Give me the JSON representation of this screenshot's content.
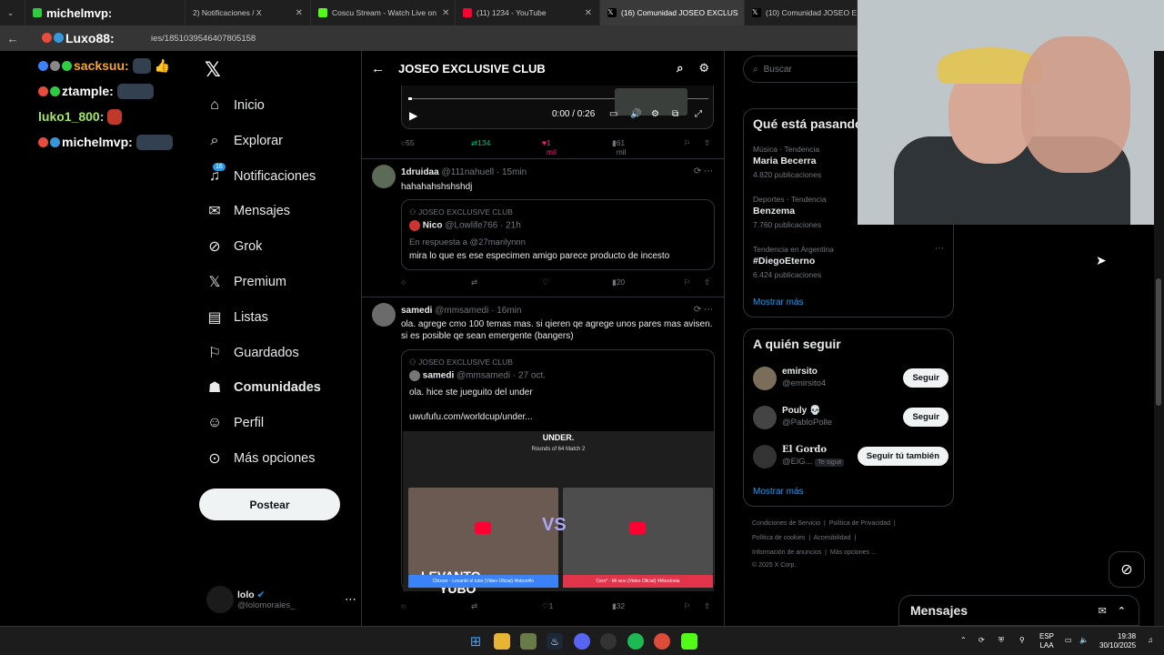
{
  "browser": {
    "tabs": [
      {
        "label": "michelmvp:",
        "color": "#2ecc40",
        "active": false
      },
      {
        "label": "2) Notificaciones / X",
        "color": "#000000",
        "active": false
      },
      {
        "label": "Coscu Stream - Watch Live on",
        "color": "#53fc18",
        "active": false
      },
      {
        "label": "(11) 1234 - YouTube",
        "color": "#ff0033",
        "active": false
      },
      {
        "label": "(16) Comunidad JOSEO EXCLUS",
        "color": "#000000",
        "active": true
      },
      {
        "label": "(10) Comunidad JOSEO EXCL",
        "color": "#000000",
        "active": false
      }
    ],
    "url": "ies/1851039546407805158",
    "url_overlay_user": "Luxo88:"
  },
  "chat_overlay": [
    {
      "user": "sacksuu:",
      "color": "#f5a623"
    },
    {
      "user": "ztample:",
      "color": "#ffffff"
    },
    {
      "user": "luko1_800:",
      "color": "#a5e65a"
    },
    {
      "user": "michelmvp:",
      "color": "#ffffff"
    }
  ],
  "sidebar": {
    "items": [
      {
        "label": "Inicio",
        "icon": "home-icon",
        "glyph": "⌂"
      },
      {
        "label": "Explorar",
        "icon": "search-icon",
        "glyph": "⌕"
      },
      {
        "label": "Notificaciones",
        "icon": "bell-icon",
        "glyph": "🔔"
      },
      {
        "label": "Mensajes",
        "icon": "mail-icon",
        "glyph": "✉"
      },
      {
        "label": "Grok",
        "icon": "grok-icon",
        "glyph": "⊘"
      },
      {
        "label": "Premium",
        "icon": "x-icon",
        "glyph": "𝕏"
      },
      {
        "label": "Listas",
        "icon": "list-icon",
        "glyph": "☰"
      },
      {
        "label": "Guardados",
        "icon": "bookmark-icon",
        "glyph": "⚑"
      },
      {
        "label": "Comunidades",
        "icon": "communities-icon",
        "glyph": "👥"
      },
      {
        "label": "Perfil",
        "icon": "profile-icon",
        "glyph": "☺"
      },
      {
        "label": "Más opciones",
        "icon": "more-icon",
        "glyph": "⋯"
      }
    ],
    "notif_count": "16",
    "post_label": "Postear",
    "profile": {
      "name": "lolo",
      "handle": "@lolomorales_"
    }
  },
  "main": {
    "title": "JOSEO EXCLUSIVE CLUB",
    "video": {
      "time": "0:00 / 0:26"
    },
    "first_actions": {
      "replies": "55",
      "reposts": "134",
      "likes": "1 mil",
      "views": "61 mil"
    },
    "tweets": [
      {
        "name": "1druidaa",
        "handle": "@111nahuell",
        "time": "15min",
        "text": "hahahahshshshdj",
        "quote": {
          "community": "JOSEO EXCLUSIVE CLUB",
          "name": "Nico",
          "handle": "@Lowlife766",
          "time": "21h",
          "reply_to": "En respuesta a @27marilynnn",
          "text": "mira lo que es ese especimen amigo parece producto de incesto"
        },
        "views": "20"
      },
      {
        "name": "samedi",
        "handle": "@mmsamedi",
        "time": "16min",
        "text": "ola. agrege cmo 100 temas mas. si qieren qe agrege unos pares mas avisen. si es posible qe sean emergente (bangers)",
        "quote": {
          "community": "JOSEO EXCLUSIVE CLUB",
          "name": "samedi",
          "handle": "@mmsamedi",
          "time": "27 oct.",
          "text": "ola. hice ste jueguito del under",
          "link": "uwufufu.com/worldcup/under...",
          "image": {
            "title": "UNDER.",
            "round": "Rounds of 64 Match 2",
            "left_title": "LEVANTO",
            "left_sub": "YUBO",
            "vs": "VS",
            "left_caption": "Chizzer - Levantó el tubo (Video Oficial) #lobon#lo",
            "right_caption": "Cero* - Mi woo (Video Oficial) #Mondonia"
          }
        },
        "likes": "1",
        "views": "32"
      }
    ]
  },
  "right": {
    "search_placeholder": "Buscar",
    "trending_title": "Qué está pasando",
    "trends": [
      {
        "cat": "Música · Tendencia",
        "name": "Maria Becerra",
        "count": "4.820 publicaciones"
      },
      {
        "cat": "Deportes · Tendencia",
        "name": "Benzema",
        "count": "7.760 publicaciones"
      },
      {
        "cat": "Tendencia en Argentina",
        "name": "#DiegoEterno",
        "count": "6.424 publicaciones"
      }
    ],
    "show_more": "Mostrar más",
    "follow_title": "A quién seguir",
    "follows": [
      {
        "name": "emirsito",
        "handle": "@emirsito4",
        "button": "Seguir"
      },
      {
        "name": "Pouly 💀",
        "handle": "@PabloPolle",
        "button": "Seguir"
      },
      {
        "name": "El Gordo",
        "handle": "@ElG...",
        "button": "Seguir tú también",
        "tag": "Te sigue"
      }
    ],
    "footer": [
      "Condiciones de Servicio",
      "Política de Privacidad",
      "Política de cookies",
      "Accesibilidad",
      "Información de anuncios",
      "Más opciones ...",
      "© 2025 X Corp."
    ]
  },
  "messages": {
    "label": "Mensajes"
  },
  "taskbar": {
    "lang": "ESP",
    "region": "LAA",
    "time": "19:38",
    "date": "30/10/2025"
  }
}
